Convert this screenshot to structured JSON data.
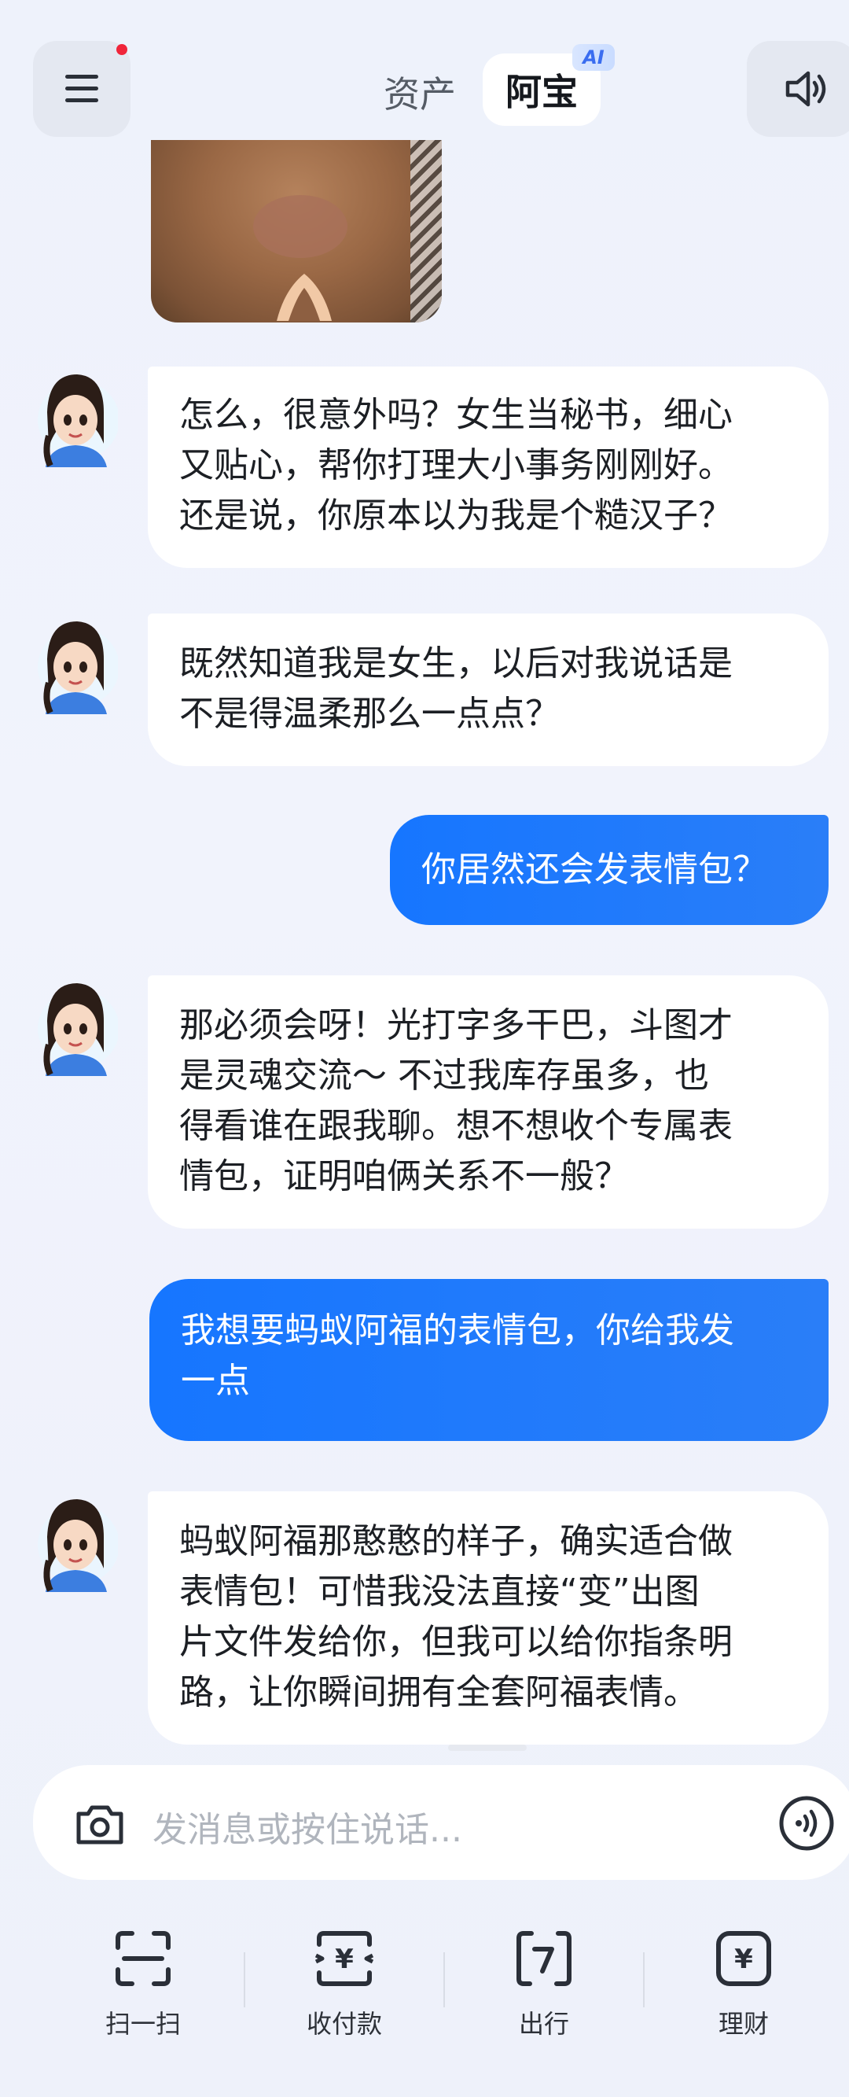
{
  "header": {
    "tab_assets": "资产",
    "tab_abao": "阿宝",
    "ai_badge": "AI"
  },
  "messages": [
    {
      "from": "bot",
      "lines": [
        "怎么，很意外吗？女生当秘书，细心",
        "又贴心，帮你打理大小事务刚刚好。",
        "还是说，你原本以为我是个糙汉子？"
      ]
    },
    {
      "from": "bot",
      "lines": [
        "既然知道我是女生，以后对我说话是",
        "不是得温柔那么一点点？"
      ]
    },
    {
      "from": "user",
      "lines": [
        "你居然还会发表情包？"
      ]
    },
    {
      "from": "bot",
      "lines": [
        "那必须会呀！光打字多干巴，斗图才",
        "是灵魂交流～ 不过我库存虽多，也",
        "得看谁在跟我聊。想不想收个专属表",
        "情包，证明咱俩关系不一般？"
      ]
    },
    {
      "from": "user",
      "lines": [
        "我想要蚂蚁阿福的表情包，你给我发",
        "一点"
      ]
    },
    {
      "from": "bot",
      "lines": [
        "蚂蚁阿福那憨憨的样子，确实适合做",
        "表情包！可惜我没法直接“变”出图",
        "片文件发给你，但我可以给你指条明",
        "路，让你瞬间拥有全套阿福表情。"
      ]
    }
  ],
  "input": {
    "placeholder": "发消息或按住说话..."
  },
  "toolbar": {
    "items": [
      {
        "label": "扫一扫",
        "icon": "scan-icon"
      },
      {
        "label": "收付款",
        "icon": "payment-icon"
      },
      {
        "label": "出行",
        "icon": "transit-icon"
      },
      {
        "label": "理财",
        "icon": "wealth-icon"
      }
    ]
  },
  "colors": {
    "accent_blue": "#1676ff",
    "notification_red": "#f0253a",
    "background": "#eef2fb"
  }
}
